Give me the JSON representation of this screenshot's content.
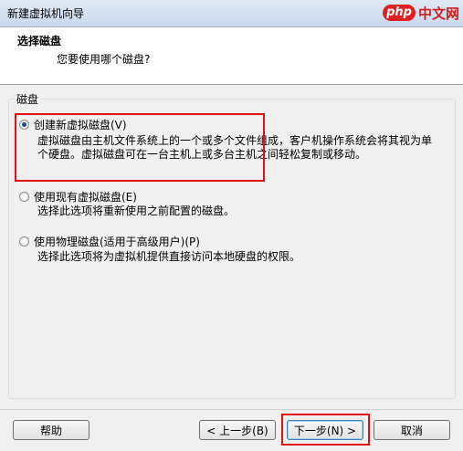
{
  "window": {
    "title": "新建虚拟机向导"
  },
  "watermark": {
    "badge": "php",
    "site": "中文网"
  },
  "header": {
    "title": "选择磁盘",
    "subtitle": "您要使用哪个磁盘?"
  },
  "group": {
    "label": "磁盘",
    "options": [
      {
        "label": "创建新虚拟磁盘(V)",
        "desc_lines": [
          "虚拟磁盘由主机文件系统上的一个或多个文件组成，客户机操作系统会将其视为单",
          "个硬盘。虚拟磁盘可在一台主机上或多台主机之间轻松复制或移动。"
        ],
        "checked": true
      },
      {
        "label": "使用现有虚拟磁盘(E)",
        "desc_lines": [
          "选择此选项将重新使用之前配置的磁盘。"
        ],
        "checked": false
      },
      {
        "label": "使用物理磁盘(适用于高级用户)(P)",
        "desc_lines": [
          "选择此选项将为虚拟机提供直接访问本地硬盘的权限。"
        ],
        "checked": false
      }
    ]
  },
  "buttons": {
    "help": "帮助",
    "back": "< 上一步(B)",
    "next": "下一步(N) >",
    "cancel": "取消"
  },
  "colors": {
    "highlight": "#e01010",
    "accent": "#1f4f8f"
  }
}
